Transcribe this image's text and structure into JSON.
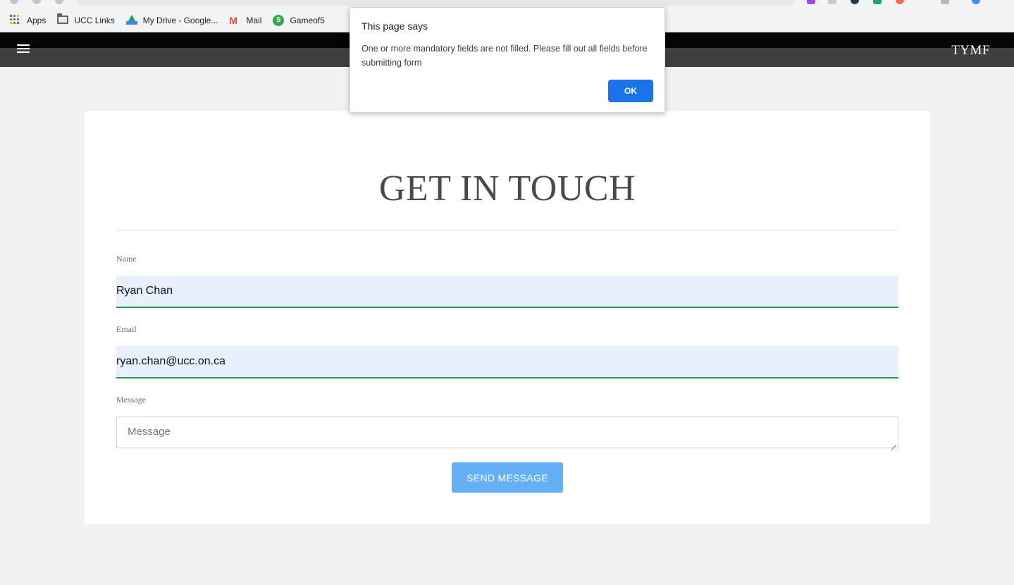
{
  "browser": {
    "bookmarks": [
      {
        "label": "Apps",
        "icon": "apps-grid-icon"
      },
      {
        "label": "UCC Links",
        "icon": "folder-icon"
      },
      {
        "label": "My Drive - Google...",
        "icon": "google-drive-icon"
      },
      {
        "label": "Mail",
        "icon": "gmail-icon"
      },
      {
        "label": "Gameof5",
        "icon": "gameof5-icon"
      }
    ]
  },
  "site": {
    "brand": "TYMF",
    "menu_icon": "hamburger-menu-icon"
  },
  "form": {
    "title": "GET IN TOUCH",
    "name_label": "Name",
    "name_value": "Ryan Chan",
    "email_label": "Email",
    "email_value": "ryan.chan@ucc.on.ca",
    "message_label": "Message",
    "message_placeholder": "Message",
    "submit_label": "SEND MESSAGE"
  },
  "dialog": {
    "title": "This page says",
    "message": "One or more mandatory fields are not filled. Please fill out all fields before submitting form",
    "ok_label": "OK"
  },
  "colors": {
    "header_bg": "#3f3f3f",
    "autofill_bg": "#e8f0fe",
    "valid_border": "#1e9e47",
    "submit_bg": "#64b0f6",
    "ok_bg": "#1a73e8"
  }
}
